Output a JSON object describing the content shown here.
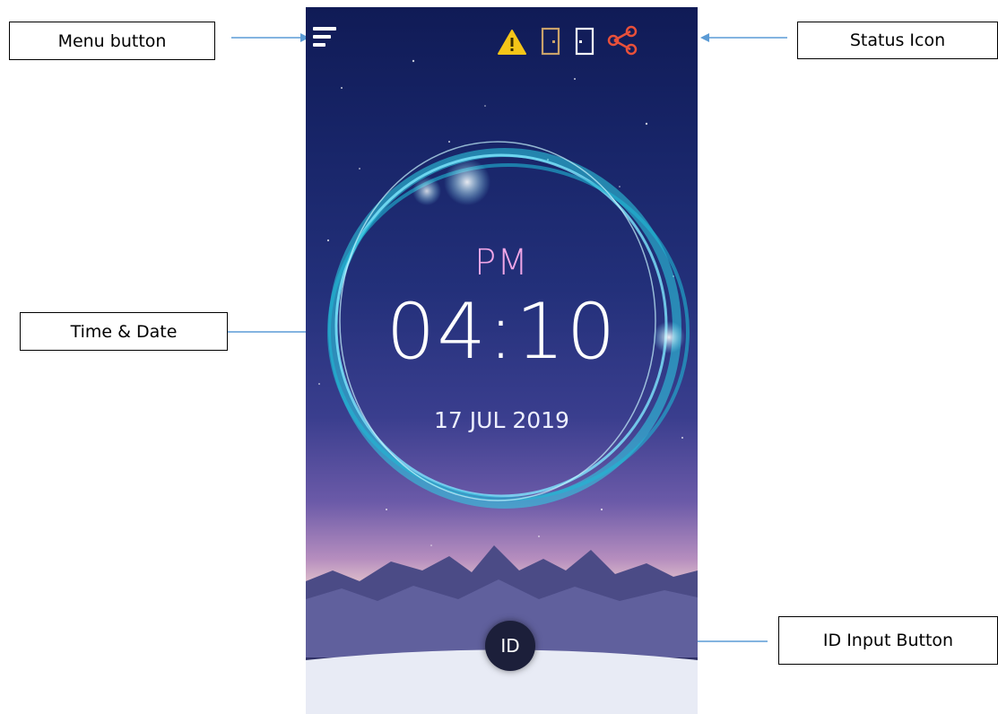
{
  "callouts": {
    "menu": "Menu button",
    "status": "Status Icon",
    "time": "Time & Date",
    "id_input": "ID Input Button"
  },
  "clock": {
    "ampm": "PM",
    "time": "04:10",
    "date": "17 JUL 2019"
  },
  "id_button": {
    "label": "ID"
  },
  "icons": {
    "menu": "menu-icon",
    "status": [
      "warning-icon",
      "door-icon",
      "door-icon",
      "network-share-icon"
    ]
  },
  "colors": {
    "warning": "#f5c518",
    "door_1": "#c9a26a",
    "door_2": "#ffffff",
    "network": "#e8503a",
    "ampm": "#f0a6e6",
    "ring": "#2ed3e6",
    "leader_line": "#5b9bd5"
  }
}
